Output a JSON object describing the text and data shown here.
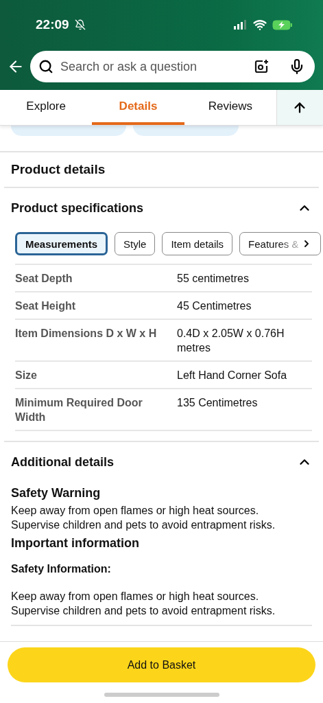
{
  "status_bar": {
    "time": "22:09",
    "silent": true
  },
  "search": {
    "placeholder": "Search or ask a question"
  },
  "tabs": [
    {
      "label": "Explore",
      "selected": false
    },
    {
      "label": "Details",
      "selected": true
    },
    {
      "label": "Reviews",
      "selected": false
    }
  ],
  "product_details": {
    "title": "Product details"
  },
  "specifications": {
    "title": "Product specifications",
    "expanded": true,
    "filters": [
      {
        "label": "Measurements",
        "selected": true
      },
      {
        "label": "Style",
        "selected": false
      },
      {
        "label": "Item details",
        "selected": false
      },
      {
        "label": "Features &",
        "selected": false
      }
    ],
    "rows": [
      {
        "name": "Seat Depth",
        "value": "55 centimetres"
      },
      {
        "name": "Seat Height",
        "value": "45 Centimetres"
      },
      {
        "name": "Item Dimensions D x W x H",
        "value": "0.4D x 2.05W x 0.76H metres"
      },
      {
        "name": "Size",
        "value": "Left Hand Corner Sofa"
      },
      {
        "name": "Minimum Required Door Width",
        "value": "135 Centimetres"
      }
    ]
  },
  "additional": {
    "title": "Additional details",
    "expanded": true,
    "blocks": [
      {
        "kind": "heading",
        "text": "Safety Warning"
      },
      {
        "kind": "paragraph",
        "text": "Keep away from open flames or high heat sources. Supervise children and pets to avoid entrapment risks."
      },
      {
        "kind": "heading",
        "text": "Important information"
      },
      {
        "kind": "subheading",
        "text": "Safety Information:"
      },
      {
        "kind": "paragraph",
        "text": "Keep away from open flames or high heat sources. Supervise children and pets to avoid entrapment risks."
      }
    ]
  },
  "add_button": {
    "label": "Add to Basket"
  }
}
